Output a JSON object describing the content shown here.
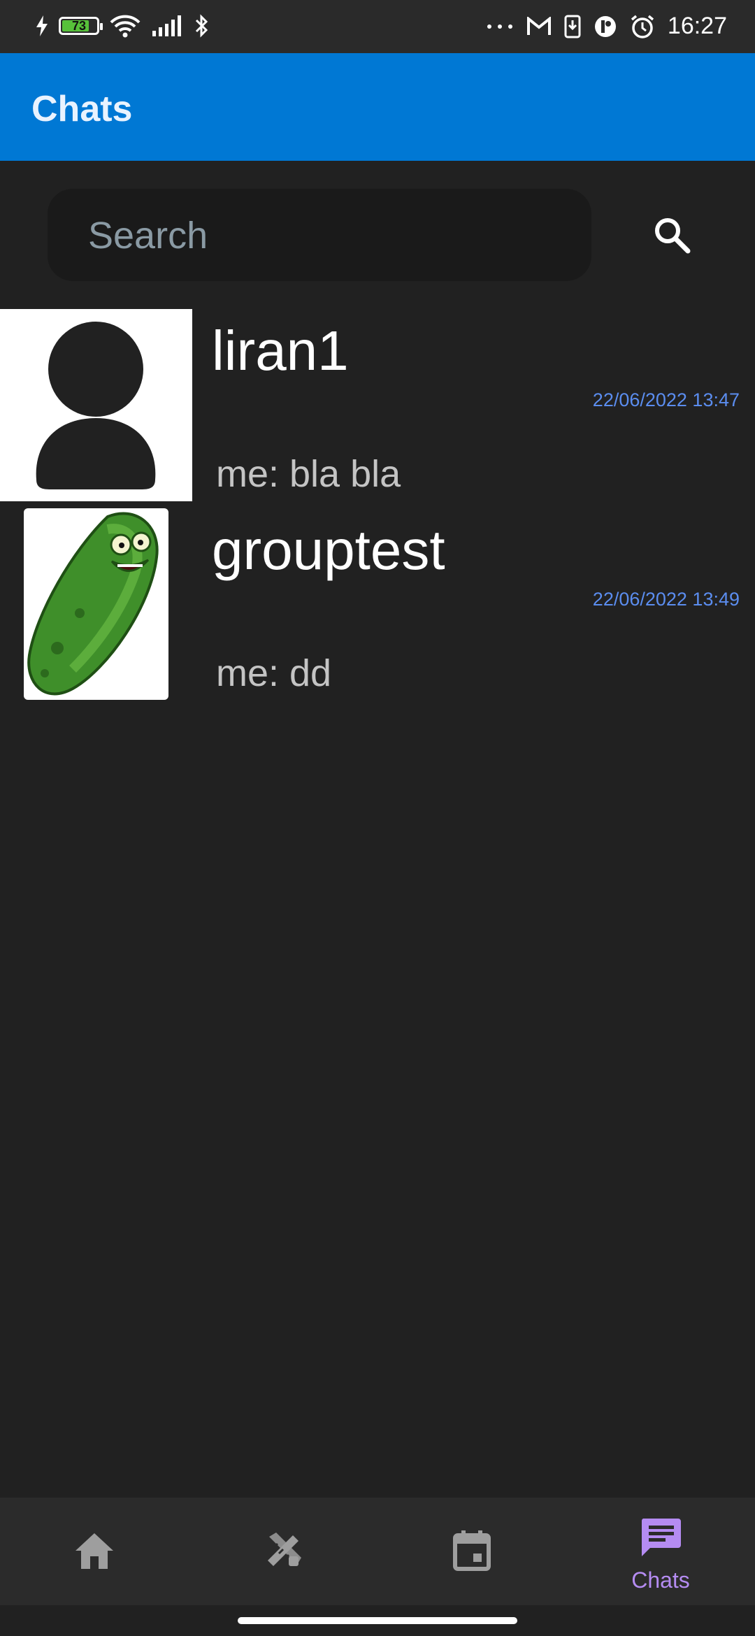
{
  "status_bar": {
    "battery_level": "73",
    "time": "16:27",
    "left_icons": [
      "charging-bolt-icon",
      "battery-icon",
      "wifi-icon",
      "cellular-signal-icon",
      "bluetooth-icon"
    ],
    "right_icons": [
      "more-dots-icon",
      "gmail-icon",
      "download-icon",
      "app-notification-icon",
      "alarm-icon"
    ]
  },
  "app_bar": {
    "title": "Chats",
    "color": "#0078d4"
  },
  "search": {
    "placeholder": "Search",
    "value": ""
  },
  "chats": [
    {
      "name": "liran1",
      "timestamp": "22/06/2022 13:47",
      "last_message": "me: bla bla",
      "avatar": "default-person-avatar"
    },
    {
      "name": "grouptest",
      "timestamp": "22/06/2022 13:49",
      "last_message": "me: dd",
      "avatar": "pickle-avatar"
    }
  ],
  "bottom_nav": {
    "items": [
      {
        "icon": "home-icon",
        "label": "",
        "active": false
      },
      {
        "icon": "tools-icon",
        "label": "",
        "active": false
      },
      {
        "icon": "calendar-icon",
        "label": "",
        "active": false
      },
      {
        "icon": "chat-icon",
        "label": "Chats",
        "active": true
      }
    ],
    "active_color": "#b58cf2",
    "inactive_color": "#9e9e9e"
  },
  "colors": {
    "background": "#212121",
    "timestamp": "#5b8def"
  }
}
